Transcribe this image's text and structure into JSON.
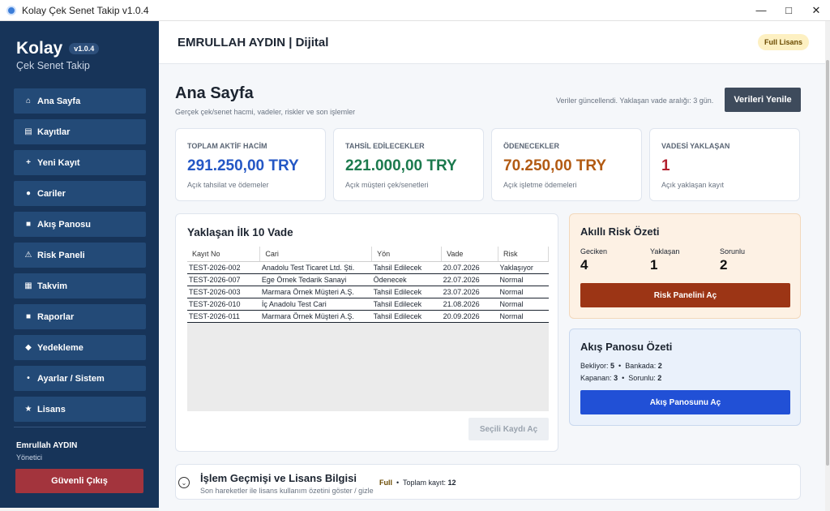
{
  "window": {
    "title": "Kolay Çek Senet Takip v1.0.4"
  },
  "sidebar": {
    "brand": "Kolay",
    "version": "v1.0.4",
    "subtitle": "Çek Senet Takip",
    "items": [
      {
        "label": "Ana Sayfa",
        "icon": "home-icon"
      },
      {
        "label": "Kayıtlar",
        "icon": "list-icon"
      },
      {
        "label": "Yeni Kayıt",
        "icon": "plus-icon"
      },
      {
        "label": "Cariler",
        "icon": "circle-icon"
      },
      {
        "label": "Akış Panosu",
        "icon": "square-icon"
      },
      {
        "label": "Risk Paneli",
        "icon": "warning-icon"
      },
      {
        "label": "Takvim",
        "icon": "calendar-icon"
      },
      {
        "label": "Raporlar",
        "icon": "square-icon"
      },
      {
        "label": "Yedekleme",
        "icon": "diamond-icon"
      },
      {
        "label": "Ayarlar / Sistem",
        "icon": "dot-icon"
      },
      {
        "label": "Lisans",
        "icon": "star-icon"
      }
    ],
    "user_name": "Emrullah AYDIN",
    "user_role": "Yönetici",
    "logout_label": "Güvenli Çıkış"
  },
  "header": {
    "company": "EMRULLAH AYDIN | Dijital",
    "license_badge": "Full Lisans"
  },
  "page": {
    "title": "Ana Sayfa",
    "subtitle": "Gerçek çek/senet hacmi, vadeler, riskler ve son işlemler",
    "refresh_status": "Veriler güncellendi. Yaklaşan vade aralığı: 3 gün.",
    "refresh_label": "Verileri Yenile"
  },
  "stats": [
    {
      "label": "TOPLAM AKTİF HACİM",
      "value": "291.250,00 TRY",
      "hint": "Açık tahsilat ve ödemeler",
      "color": "#2457c5"
    },
    {
      "label": "TAHSİL EDİLECEKLER",
      "value": "221.000,00 TRY",
      "hint": "Açık müşteri çek/senetleri",
      "color": "#1c7a4e"
    },
    {
      "label": "ÖDENECEKLER",
      "value": "70.250,00 TRY",
      "hint": "Açık işletme ödemeleri",
      "color": "#b25a12"
    },
    {
      "label": "VADESİ YAKLAŞAN",
      "value": "1",
      "hint": "Açık yaklaşan kayıt",
      "color": "#b21f2e"
    }
  ],
  "upcoming": {
    "title": "Yaklaşan İlk 10 Vade",
    "columns": [
      "Kayıt No",
      "Cari",
      "Yön",
      "Vade",
      "Risk"
    ],
    "rows": [
      [
        "TEST-2026-002",
        "Anadolu Test Ticaret Ltd. Şti.",
        "Tahsil Edilecek",
        "20.07.2026",
        "Yaklaşıyor"
      ],
      [
        "TEST-2026-007",
        "Ege Örnek Tedarik Sanayi",
        "Ödenecek",
        "22.07.2026",
        "Normal"
      ],
      [
        "TEST-2026-003",
        "Marmara Örnek Müşteri A.Ş.",
        "Tahsil Edilecek",
        "23.07.2026",
        "Normal"
      ],
      [
        "TEST-2026-010",
        "İç Anadolu Test Cari",
        "Tahsil Edilecek",
        "21.08.2026",
        "Normal"
      ],
      [
        "TEST-2026-011",
        "Marmara Örnek Müşteri A.Ş.",
        "Tahsil Edilecek",
        "20.09.2026",
        "Normal"
      ]
    ],
    "open_selected_label": "Seçili Kaydı Aç"
  },
  "risk_summary": {
    "title": "Akıllı Risk Özeti",
    "late_label": "Geciken",
    "late_value": "4",
    "upcoming_label": "Yaklaşan",
    "upcoming_value": "1",
    "problem_label": "Sorunlu",
    "problem_value": "2",
    "button_label": "Risk Panelini Aç"
  },
  "flow_summary": {
    "title": "Akış Panosu Özeti",
    "waiting_label": "Bekliyor:",
    "waiting_value": "5",
    "bank_label": "Bankada:",
    "bank_value": "2",
    "closed_label": "Kapanan:",
    "closed_value": "3",
    "problem_label": "Sorunlu:",
    "problem_value": "2",
    "button_label": "Akış Panosunu Aç"
  },
  "history": {
    "title": "İşlem Geçmişi ve Lisans Bilgisi",
    "subtitle": "Son hareketler ile lisans kullanım özetini göster / gizle",
    "license": "Full",
    "total_label": "Toplam kayıt:",
    "total_value": "12"
  }
}
